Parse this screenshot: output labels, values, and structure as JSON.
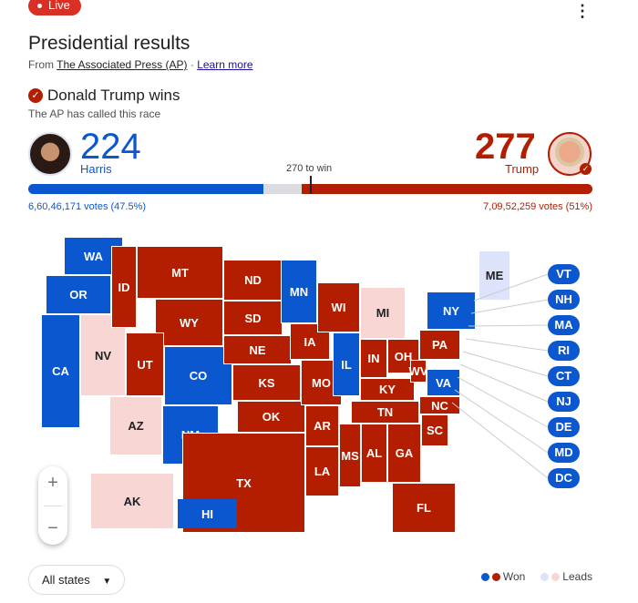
{
  "header": {
    "live": "Live",
    "title": "Presidential results",
    "from": "From",
    "source": "The Associated Press (AP)",
    "sep": " · ",
    "learn_more": "Learn more"
  },
  "result": {
    "headline": "Donald Trump wins",
    "subtitle": "The AP has called this race"
  },
  "candidates": {
    "harris": {
      "name": "Harris",
      "electoral": "224",
      "votes": "6,60,46,171 votes (47.5%)",
      "electoral_value": 224
    },
    "trump": {
      "name": "Trump",
      "electoral": "277",
      "votes": "7,09,52,259 votes (51%)",
      "electoral_value": 277
    }
  },
  "threshold": "270 to win",
  "total_electoral": 538,
  "colors": {
    "dem_won": "#0b57d0",
    "rep_won": "#b31e00",
    "dem_leads": "#dde3fb",
    "rep_leads": "#f8d6d3"
  },
  "states": [
    {
      "code": "WA",
      "s": "dem_won"
    },
    {
      "code": "OR",
      "s": "dem_won"
    },
    {
      "code": "CA",
      "s": "dem_won"
    },
    {
      "code": "NV",
      "s": "rep_leads"
    },
    {
      "code": "ID",
      "s": "rep_won"
    },
    {
      "code": "MT",
      "s": "rep_won"
    },
    {
      "code": "WY",
      "s": "rep_won"
    },
    {
      "code": "UT",
      "s": "rep_won"
    },
    {
      "code": "AZ",
      "s": "rep_leads"
    },
    {
      "code": "CO",
      "s": "dem_won"
    },
    {
      "code": "NM",
      "s": "dem_won"
    },
    {
      "code": "ND",
      "s": "rep_won"
    },
    {
      "code": "SD",
      "s": "rep_won"
    },
    {
      "code": "NE",
      "s": "rep_won"
    },
    {
      "code": "KS",
      "s": "rep_won"
    },
    {
      "code": "OK",
      "s": "rep_won"
    },
    {
      "code": "TX",
      "s": "rep_won"
    },
    {
      "code": "MN",
      "s": "dem_won"
    },
    {
      "code": "IA",
      "s": "rep_won"
    },
    {
      "code": "MO",
      "s": "rep_won"
    },
    {
      "code": "AR",
      "s": "rep_won"
    },
    {
      "code": "LA",
      "s": "rep_won"
    },
    {
      "code": "WI",
      "s": "rep_won"
    },
    {
      "code": "IL",
      "s": "dem_won"
    },
    {
      "code": "MI",
      "s": "rep_leads"
    },
    {
      "code": "IN",
      "s": "rep_won"
    },
    {
      "code": "OH",
      "s": "rep_won"
    },
    {
      "code": "KY",
      "s": "rep_won"
    },
    {
      "code": "TN",
      "s": "rep_won"
    },
    {
      "code": "MS",
      "s": "rep_won"
    },
    {
      "code": "AL",
      "s": "rep_won"
    },
    {
      "code": "GA",
      "s": "rep_won"
    },
    {
      "code": "FL",
      "s": "rep_won"
    },
    {
      "code": "SC",
      "s": "rep_won"
    },
    {
      "code": "NC",
      "s": "rep_won"
    },
    {
      "code": "VA",
      "s": "dem_won"
    },
    {
      "code": "WV",
      "s": "rep_won"
    },
    {
      "code": "PA",
      "s": "rep_won"
    },
    {
      "code": "NY",
      "s": "dem_won"
    },
    {
      "code": "ME",
      "s": "dem_leads"
    },
    {
      "code": "AK",
      "s": "rep_leads"
    },
    {
      "code": "HI",
      "s": "dem_won"
    }
  ],
  "small_states": [
    "VT",
    "NH",
    "MA",
    "RI",
    "CT",
    "NJ",
    "DE",
    "MD",
    "DC"
  ],
  "zoom": {
    "in": "+",
    "out": "−"
  },
  "filter": {
    "selected": "All states"
  },
  "legend": {
    "won": "Won",
    "leads": "Leads"
  }
}
